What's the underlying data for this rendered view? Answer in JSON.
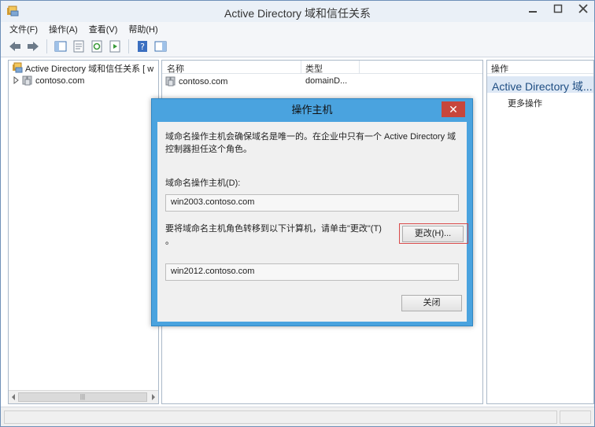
{
  "window": {
    "title": "Active Directory 域和信任关系"
  },
  "menu": [
    "文件(F)",
    "操作(A)",
    "查看(V)",
    "帮助(H)"
  ],
  "tree": {
    "root": "Active Directory 域和信任关系 [ w",
    "child": "contoso.com",
    "hscroll_thumb": "|||"
  },
  "list": {
    "columns": [
      "名称",
      "类型"
    ],
    "rows": [
      {
        "name": "contoso.com",
        "type": "domainD..."
      }
    ]
  },
  "actions": {
    "header": "操作",
    "section": "Active Directory 域...",
    "more": "更多操作"
  },
  "dialog": {
    "title": "操作主机",
    "close": "✕",
    "desc_line1": "域命名操作主机会确保域名是唯一的。在企业中只有一个 Active Directory 域",
    "desc_line2": "控制器担任这个角色。",
    "current_label": "域命名操作主机(D):",
    "current_value": "win2003.contoso.com",
    "transfer_label": "要将域命名主机角色转移到以下计算机，请单击\"更改\"(T)",
    "transfer_label_tail": "。",
    "target_value": "win2012.contoso.com",
    "change_button": "更改(H)...",
    "close_button": "关闭"
  }
}
